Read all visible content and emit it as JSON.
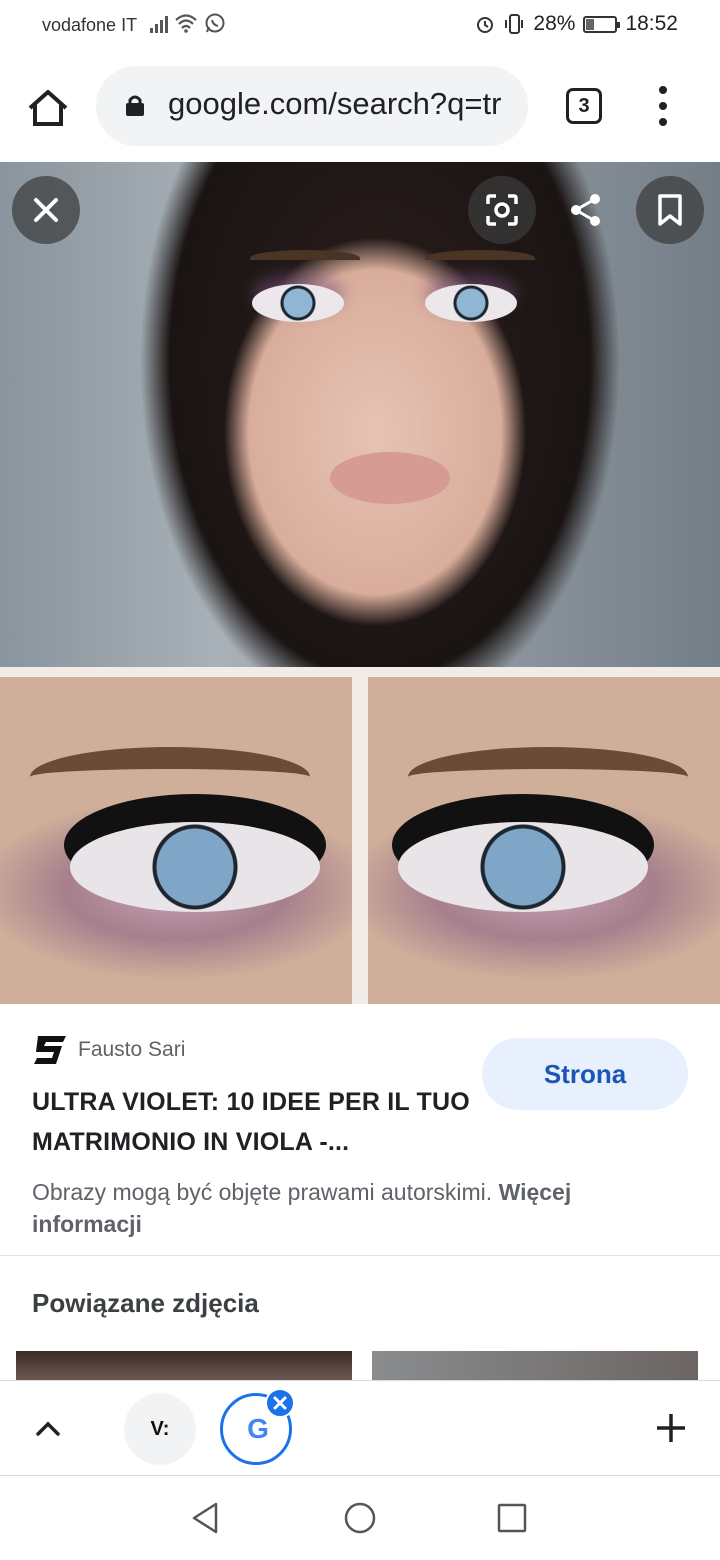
{
  "status_bar": {
    "carrier": "vodafone IT",
    "battery": "28%",
    "battery_level": 0.28,
    "time": "18:52",
    "icons": [
      "signal-icon",
      "wifi-icon",
      "whatsapp-icon",
      "alarm-icon",
      "vibrate-icon",
      "battery-icon"
    ]
  },
  "address_bar": {
    "url": "google.com/search?q=tr",
    "tab_count": "3",
    "icons": [
      "home-icon",
      "lock-icon",
      "more-vert-icon"
    ]
  },
  "image_viewer": {
    "icons": [
      "close-icon",
      "lens-icon",
      "share-icon",
      "bookmark-icon"
    ]
  },
  "result": {
    "source_name": "Fausto Sari",
    "title": "ULTRA VIOLET: 10 IDEE PER IL TUO MATRIMONIO IN VIOLA -...",
    "visit_label": "Strona",
    "copyright_text": "Obrazy mogą być objęte prawami autorskimi.",
    "more_info_label": "Więcej informacji"
  },
  "related": {
    "title": "Powiązane zdjęcia"
  },
  "tab_strip": {
    "tab_v_label": "V:",
    "tab_g_label": "G",
    "icons": [
      "chevron-up-icon",
      "tab-close-icon",
      "plus-icon"
    ]
  },
  "nav_bar": {
    "icons": [
      "back-triangle-icon",
      "home-circle-icon",
      "recents-square-icon"
    ]
  },
  "colors": {
    "accent": "#1a73e8",
    "visit_button_bg": "#e8f0fe",
    "visit_button_text": "#1a56b4"
  }
}
